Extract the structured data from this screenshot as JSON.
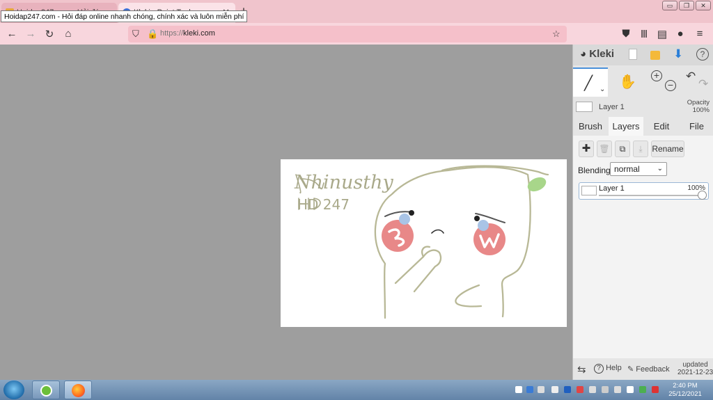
{
  "browser": {
    "tabs": [
      {
        "title": "Hoidap247.com - Hỏi đáp online nhanh chóng"
      },
      {
        "title": "Kleki - Paint Tool"
      }
    ],
    "tooltip": "Hoidap247.com - Hỏi đáp online nhanh chóng, chính xác và luôn miễn phí",
    "url_prefix": "https://",
    "url_domain": "kleki.com"
  },
  "kleki": {
    "logo": "Kleki",
    "current_layer": "Layer 1",
    "opacity_label": "Opacity",
    "opacity_value": "100%",
    "tabs": [
      "Brush",
      "Layers",
      "Edit",
      "File"
    ],
    "active_tab": "Layers",
    "rename_label": "Rename",
    "blending_label": "Blending",
    "blending_value": "normal",
    "layer_item": {
      "name": "Layer 1",
      "opacity": "100%"
    },
    "help_label": "Help",
    "feedback_label": "Feedback",
    "updated_label": "updated",
    "updated_date": "2021-12-23"
  },
  "drawing": {
    "text_line1": "Nhinusthy",
    "text_line2": "HD 247"
  },
  "taskbar": {
    "time": "2:40 PM",
    "date": "25/12/2021"
  },
  "colors": {
    "browser_chrome": "#f0c4cc",
    "workspace": "#9e9e9e",
    "panel": "#e5e5e5",
    "stroke": "#b8b896",
    "cheek": "#e88888",
    "tear": "#a9c4e6",
    "leaf": "#a8d68a"
  }
}
